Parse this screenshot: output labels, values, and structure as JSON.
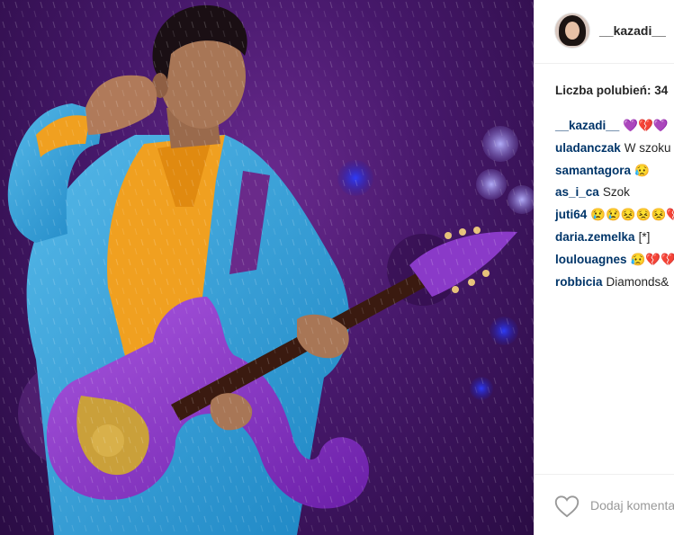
{
  "post": {
    "image_alt": "Prince playing a purple symbol-shaped guitar in the rain",
    "author": {
      "username": "__kazadi__"
    },
    "likes_text": "Liczba polubień: 34",
    "comments": [
      {
        "user": "__kazadi__",
        "text": "💜💔💜"
      },
      {
        "user": "uladanczak",
        "text": "W szoku"
      },
      {
        "user": "samantagora",
        "text": "😥"
      },
      {
        "user": "as_i_ca",
        "text": "Szok"
      },
      {
        "user": "juti64",
        "text": "😢😢😣😣😣💔"
      },
      {
        "user": "daria.zemelka",
        "text": "[*]"
      },
      {
        "user": "loulouagnes",
        "text": "😥💔💔"
      },
      {
        "user": "robbicia",
        "text": "Diamonds&"
      }
    ],
    "add_comment_placeholder": "Dodaj komentarz..."
  },
  "colors": {
    "brand_link": "#003569",
    "text": "#262626",
    "muted": "#999999"
  }
}
